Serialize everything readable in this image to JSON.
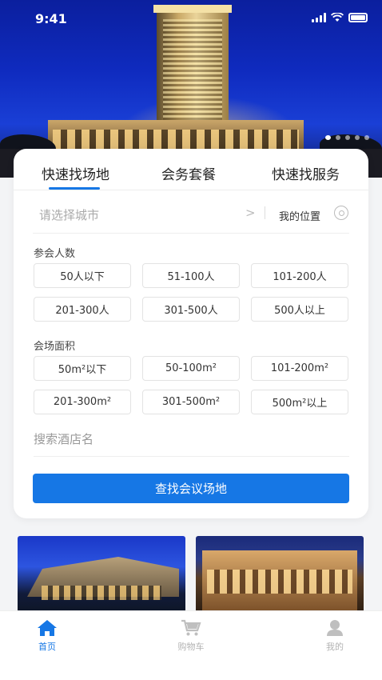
{
  "status_bar": {
    "time": "9:41"
  },
  "carousel": {
    "total": 5,
    "active": 0
  },
  "tabs": [
    {
      "label": "快速找场地",
      "active": true
    },
    {
      "label": "会务套餐",
      "active": false
    },
    {
      "label": "快速找服务",
      "active": false
    }
  ],
  "city": {
    "placeholder": "请选择城市",
    "location_label": "我的位置"
  },
  "attendees": {
    "label": "参会人数",
    "options": [
      "50人以下",
      "51-100人",
      "101-200人",
      "201-300人",
      "301-500人",
      "500人以上"
    ]
  },
  "area": {
    "label": "会场面积",
    "options": [
      "50m²以下",
      "50-100m²",
      "101-200m²",
      "201-300m²",
      "301-500m²",
      "500m²以上"
    ]
  },
  "hotel_search": {
    "placeholder": "搜索酒店名"
  },
  "search_button": "查找会议场地",
  "nav": {
    "home": "首页",
    "cart": "购物车",
    "me": "我的"
  },
  "colors": {
    "accent": "#1677e5",
    "inactive": "#b3b3b3"
  }
}
